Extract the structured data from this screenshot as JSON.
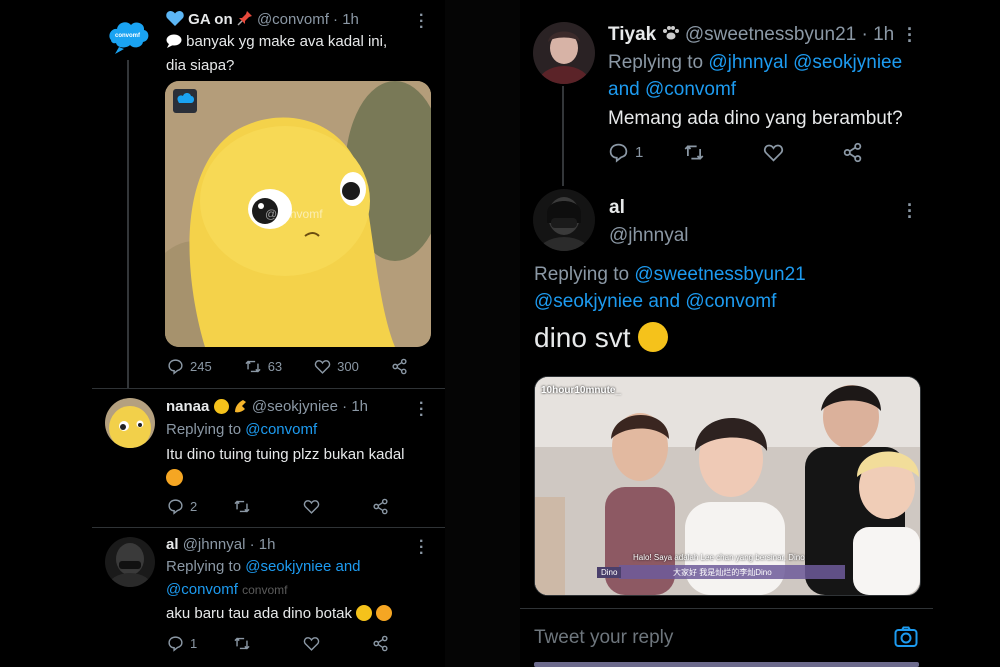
{
  "left": {
    "post": {
      "name": "GA on",
      "handle": "@convomf",
      "time": "· 1h",
      "avatar_text": "convomf",
      "text_line1": "banyak yg make ava kadal ini,",
      "text_line2": "dia siapa?",
      "watermark": "@convomf",
      "replies": "245",
      "retweets": "63",
      "likes": "300"
    },
    "reply1": {
      "name": "nanaa",
      "handle": "@seokjyniee",
      "time": "· 1h",
      "replying_label": "Replying to",
      "replying_to": "@convomf",
      "text": "Itu dino tuing tuing plzz bukan kadal",
      "replies": "2"
    },
    "reply2": {
      "name": "al",
      "handle": "@jhnnyal",
      "time": "· 1h",
      "replying_label": "Replying to",
      "replying_to_line1": "@seokjyniee and",
      "replying_to_line2": "@convomf",
      "watermark": "convomf",
      "text": "aku baru tau ada dino botak",
      "replies": "1"
    }
  },
  "right": {
    "reply1": {
      "name": "Tiyak",
      "handle": "@sweetnessbyun21",
      "time": "· 1h",
      "replying_label": "Replying to",
      "replying_line1_mentions": "@jhnnyal @seokjyniee",
      "replying_line2": "and @convomf",
      "text": "Memang ada dino yang berambut?",
      "replies": "1"
    },
    "main": {
      "name": "al",
      "handle": "@jhnnyal",
      "replying_label": "Replying to",
      "replying_line1_mention": "@sweetnessbyun21",
      "replying_line2": "@seokjyniee and @convomf",
      "text": "dino svt",
      "video_watermark": "10hour10mnute_",
      "video_label": "Dino",
      "video_subtitle_1": "Halo! Saya adalah Lee chan yang bersinar, Dino",
      "video_subtitle_2": "大家好 我是灿烂的李灿Dino"
    },
    "compose": {
      "placeholder": "Tweet your reply"
    }
  },
  "colors": {
    "background": "#000000",
    "accent": "#1d9bf0",
    "muted": "#8b98a5",
    "text": "#e7e9ea"
  },
  "icons": [
    "heart-icon",
    "pin-icon",
    "speech-bubble-icon",
    "reply-icon",
    "retweet-icon",
    "like-icon",
    "share-icon",
    "more-icon",
    "paw-icon",
    "camera-icon"
  ]
}
